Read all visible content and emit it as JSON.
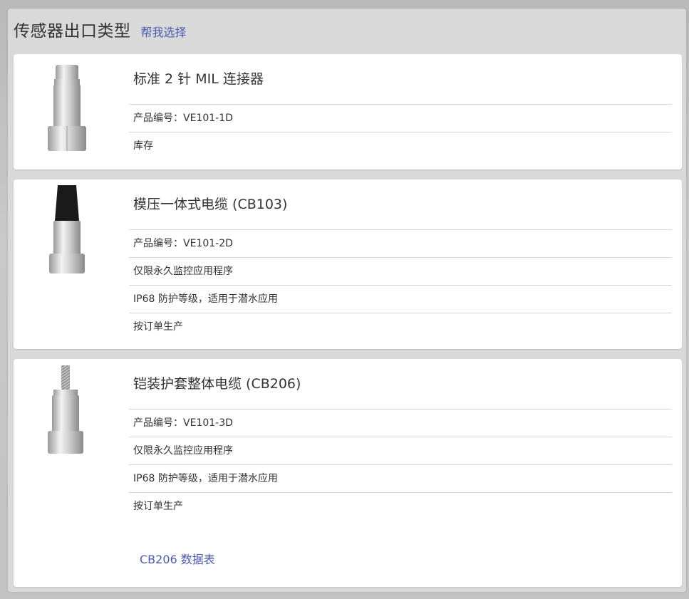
{
  "header": {
    "title": "传感器出口类型",
    "help_link": "帮我选择"
  },
  "options": [
    {
      "title": "标准 2 针 MIL 连接器",
      "attributes": [
        "产品编号：VE101-1D",
        "库存"
      ],
      "image": "mil-connector-sensor-icon"
    },
    {
      "title": "模压一体式电缆 (CB103)",
      "attributes": [
        "产品编号：VE101-2D",
        "仅限永久监控应用程序",
        "IP68 防护等级，适用于潜水应用",
        "按订单生产"
      ],
      "image": "molded-cable-sensor-icon"
    },
    {
      "title": "铠装护套整体电缆 (CB206)",
      "attributes": [
        "产品编号：VE101-3D",
        "仅限永久监控应用程序",
        "IP68 防护等级，适用于潜水应用",
        "按订单生产"
      ],
      "image": "armored-cable-sensor-icon",
      "datasheet_link": "CB206 数据表"
    }
  ],
  "colors": {
    "link": "#4b5bb0",
    "card_bg": "#ffffff",
    "panel_bg": "#d9d9d9"
  }
}
